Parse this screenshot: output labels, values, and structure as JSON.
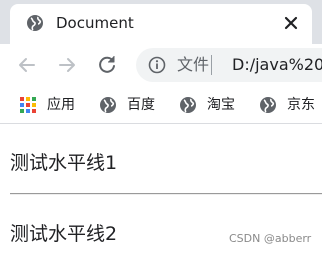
{
  "tab": {
    "title": "Document",
    "favicon": "globe-icon",
    "close_icon": "close-icon"
  },
  "toolbar": {
    "back_icon": "back-arrow-icon",
    "forward_icon": "forward-arrow-icon",
    "reload_icon": "reload-icon",
    "info_icon": "info-icon",
    "scheme_label": "文件",
    "url": "D:/java%20"
  },
  "bookmarks": [
    {
      "label": "应用",
      "icon": "apps-grid-icon"
    },
    {
      "label": "百度",
      "icon": "globe-icon"
    },
    {
      "label": "淘宝",
      "icon": "globe-icon"
    },
    {
      "label": "京东",
      "icon": "globe-icon"
    }
  ],
  "page": {
    "text1": "测试水平线1",
    "text2": "测试水平线2"
  },
  "watermark": "CSDN @abberr",
  "colors": {
    "tabstrip_bg": "#dee1e6",
    "omnibox_bg": "#f1f3f4",
    "icon_gray": "#5f6368",
    "icon_disabled": "#bdc1c6",
    "apps_red": "#ea4335",
    "apps_yellow": "#fbbc04",
    "apps_green": "#34a853",
    "apps_blue": "#4285f4"
  }
}
